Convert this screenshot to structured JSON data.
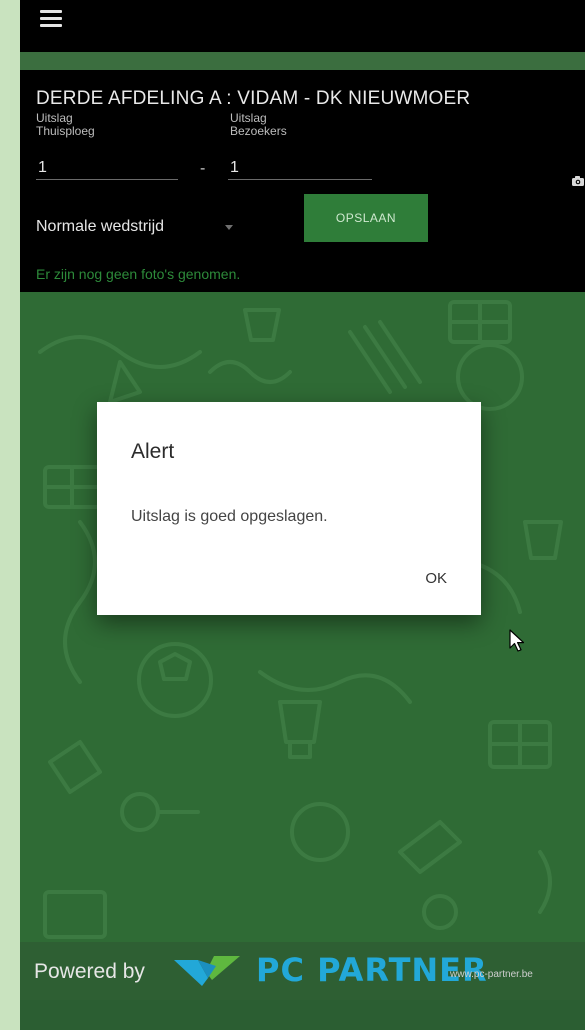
{
  "topbar": {
    "menu_icon": "hamburger-menu-icon"
  },
  "match": {
    "title": "DERDE AFDELING A : VIDAM - DK NIEUWMOER",
    "home_label_line1": "Uitslag",
    "home_label_line2": "Thuisploeg",
    "away_label_line1": "Uitslag",
    "away_label_line2": "Bezoekers",
    "home_score": "1",
    "separator": "-",
    "away_score": "1",
    "match_type": "Normale wedstrijd",
    "save_label": "OPSLAAN",
    "photos_message": "Er zijn nog geen foto's genomen.",
    "camera_icon": "camera-icon"
  },
  "dialog": {
    "title": "Alert",
    "message": "Uitslag is goed opgeslagen.",
    "ok_label": "OK"
  },
  "footer": {
    "powered_by": "Powered by",
    "logo_text": "PC PARTNER",
    "logo_url": "www.pc-partner.be"
  },
  "colors": {
    "background_green": "#2f6b35",
    "header_black": "#000000",
    "save_button_green": "#2f7d39",
    "photos_text_green": "#2d8a3a",
    "logo_blue": "#22a8d8",
    "outer_background": "#c9e3bf"
  }
}
